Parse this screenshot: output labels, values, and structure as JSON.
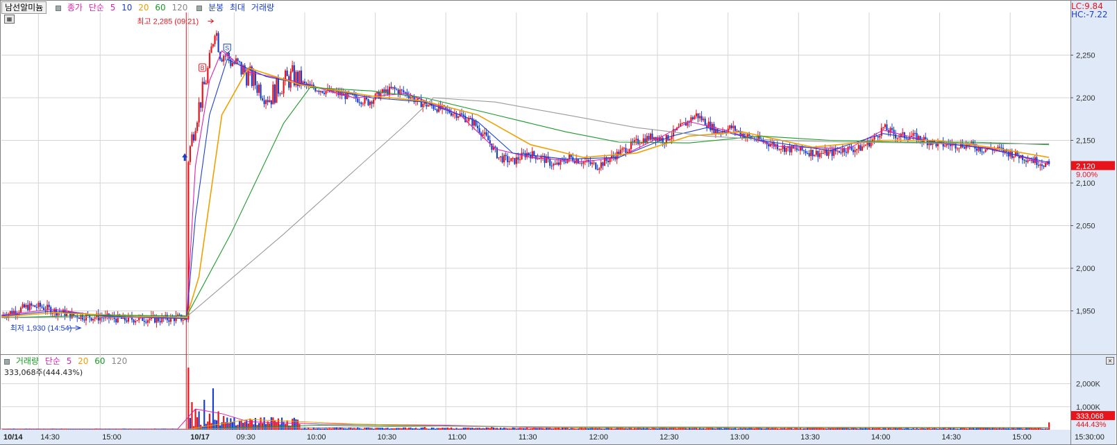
{
  "header": {
    "stock_name": "남선알미늄",
    "price_ma_legend": [
      "종가",
      "단순",
      "5",
      "10",
      "20",
      "60",
      "120"
    ],
    "extra_items": [
      "분봉",
      "최대",
      "거래량"
    ],
    "lc": "LC:9.84",
    "hc": "HC:-7.22"
  },
  "volume_header": {
    "items": [
      "거래량",
      "단순",
      "5",
      "20",
      "60",
      "120"
    ],
    "value": "333,068주(444.43%)"
  },
  "colors": {
    "up": "#e8141c",
    "down": "#1a3fcf",
    "ma5": "#e020b0",
    "ma10": "#1a3fcf",
    "ma20": "#f0a000",
    "ma60": "#1a9a28",
    "ma120": "#9a9a9a",
    "axis_bg": "#dfe9f7",
    "grid": "#d5d5d5",
    "current_bg": "#e8141c"
  },
  "icons": [
    "calendar-icon",
    "buy-marker-icon",
    "sell-marker-icon",
    "low-arrow-icon"
  ],
  "chart_data": [
    {
      "type": "candlestick",
      "title": "",
      "annotations": {
        "high": "최고 2,285 (09:21)",
        "low": "최저 1,930 (14:54)",
        "buy_marker": "B",
        "sell_marker": "S"
      },
      "x_tick_labels": [
        "10/14",
        "14:30",
        "15:00",
        "10/17",
        "09:30",
        "10:00",
        "10:30",
        "11:00",
        "11:30",
        "12:00",
        "12:30",
        "13:00",
        "13:30",
        "14:00",
        "14:30",
        "15:00",
        "15:30:00"
      ],
      "y_tick_labels": [
        "2,250",
        "2,200",
        "2,150",
        "2,100",
        "2,050",
        "2,000",
        "1,950"
      ],
      "ylim": [
        1900,
        2300
      ],
      "current_price": "2,120",
      "current_change": "9.00%",
      "close_series": [
        [
          0,
          1945
        ],
        [
          8,
          1950
        ],
        [
          15,
          1955
        ],
        [
          22,
          1955
        ],
        [
          30,
          1950
        ],
        [
          40,
          1945
        ],
        [
          50,
          1943
        ],
        [
          60,
          1942
        ],
        [
          70,
          1940
        ],
        [
          80,
          1941
        ],
        [
          90,
          1940
        ],
        [
          100,
          1942
        ],
        [
          105,
          1940
        ],
        [
          106,
          2130
        ],
        [
          110,
          2175
        ],
        [
          114,
          2205
        ],
        [
          118,
          2240
        ],
        [
          121,
          2285
        ],
        [
          124,
          2255
        ],
        [
          127,
          2250
        ],
        [
          132,
          2240
        ],
        [
          138,
          2230
        ],
        [
          145,
          2215
        ],
        [
          152,
          2200
        ],
        [
          158,
          2215
        ],
        [
          165,
          2225
        ],
        [
          172,
          2215
        ],
        [
          180,
          2210
        ],
        [
          190,
          2205
        ],
        [
          200,
          2200
        ],
        [
          208,
          2195
        ],
        [
          215,
          2205
        ],
        [
          222,
          2210
        ],
        [
          230,
          2205
        ],
        [
          236,
          2195
        ],
        [
          244,
          2190
        ],
        [
          252,
          2185
        ],
        [
          260,
          2180
        ],
        [
          268,
          2170
        ],
        [
          276,
          2150
        ],
        [
          282,
          2130
        ],
        [
          290,
          2125
        ],
        [
          298,
          2135
        ],
        [
          306,
          2130
        ],
        [
          314,
          2120
        ],
        [
          322,
          2130
        ],
        [
          330,
          2125
        ],
        [
          338,
          2120
        ],
        [
          346,
          2130
        ],
        [
          354,
          2140
        ],
        [
          362,
          2150
        ],
        [
          370,
          2155
        ],
        [
          376,
          2150
        ],
        [
          382,
          2160
        ],
        [
          388,
          2170
        ],
        [
          394,
          2180
        ],
        [
          400,
          2170
        ],
        [
          406,
          2160
        ],
        [
          414,
          2165
        ],
        [
          422,
          2155
        ],
        [
          430,
          2150
        ],
        [
          438,
          2145
        ],
        [
          446,
          2140
        ],
        [
          454,
          2138
        ],
        [
          462,
          2135
        ],
        [
          470,
          2135
        ],
        [
          478,
          2140
        ],
        [
          486,
          2140
        ],
        [
          494,
          2150
        ],
        [
          500,
          2165
        ],
        [
          508,
          2155
        ],
        [
          516,
          2155
        ],
        [
          524,
          2150
        ],
        [
          532,
          2145
        ],
        [
          540,
          2145
        ],
        [
          548,
          2145
        ],
        [
          556,
          2140
        ],
        [
          564,
          2140
        ],
        [
          572,
          2135
        ],
        [
          580,
          2130
        ],
        [
          588,
          2125
        ],
        [
          594,
          2120
        ]
      ],
      "moving_averages": [
        {
          "name": "5",
          "values": [
            [
              0,
              1945
            ],
            [
              30,
              1952
            ],
            [
              60,
              1943
            ],
            [
              105,
              1941
            ],
            [
              110,
              2120
            ],
            [
              118,
              2220
            ],
            [
              125,
              2255
            ],
            [
              140,
              2230
            ],
            [
              165,
              2220
            ],
            [
              200,
              2200
            ],
            [
              230,
              2205
            ],
            [
              260,
              2180
            ],
            [
              280,
              2140
            ],
            [
              300,
              2130
            ],
            [
              330,
              2125
            ],
            [
              350,
              2130
            ],
            [
              375,
              2155
            ],
            [
              390,
              2172
            ],
            [
              410,
              2162
            ],
            [
              440,
              2143
            ],
            [
              480,
              2140
            ],
            [
              500,
              2162
            ],
            [
              530,
              2147
            ],
            [
              560,
              2141
            ],
            [
              594,
              2122
            ]
          ]
        },
        {
          "name": "10",
          "values": [
            [
              0,
              1944
            ],
            [
              30,
              1950
            ],
            [
              60,
              1944
            ],
            [
              105,
              1941
            ],
            [
              110,
              2060
            ],
            [
              118,
              2180
            ],
            [
              128,
              2245
            ],
            [
              150,
              2225
            ],
            [
              180,
              2212
            ],
            [
              210,
              2200
            ],
            [
              240,
              2195
            ],
            [
              270,
              2172
            ],
            [
              290,
              2135
            ],
            [
              320,
              2128
            ],
            [
              350,
              2130
            ],
            [
              380,
              2155
            ],
            [
              400,
              2165
            ],
            [
              430,
              2150
            ],
            [
              470,
              2138
            ],
            [
              500,
              2158
            ],
            [
              530,
              2148
            ],
            [
              560,
              2140
            ],
            [
              594,
              2124
            ]
          ]
        },
        {
          "name": "20",
          "values": [
            [
              0,
              1943
            ],
            [
              30,
              1948
            ],
            [
              60,
              1945
            ],
            [
              105,
              1942
            ],
            [
              112,
              1990
            ],
            [
              125,
              2180
            ],
            [
              140,
              2235
            ],
            [
              170,
              2215
            ],
            [
              210,
              2202
            ],
            [
              240,
              2196
            ],
            [
              270,
              2180
            ],
            [
              300,
              2145
            ],
            [
              330,
              2130
            ],
            [
              360,
              2135
            ],
            [
              390,
              2155
            ],
            [
              420,
              2160
            ],
            [
              460,
              2142
            ],
            [
              500,
              2150
            ],
            [
              530,
              2150
            ],
            [
              560,
              2142
            ],
            [
              594,
              2130
            ]
          ]
        },
        {
          "name": "60",
          "values": [
            [
              0,
              1942
            ],
            [
              60,
              1945
            ],
            [
              105,
              1944
            ],
            [
              130,
              2040
            ],
            [
              160,
              2170
            ],
            [
              175,
              2212
            ],
            [
              210,
              2208
            ],
            [
              240,
              2200
            ],
            [
              280,
              2180
            ],
            [
              320,
              2160
            ],
            [
              350,
              2148
            ],
            [
              390,
              2147
            ],
            [
              430,
              2155
            ],
            [
              470,
              2150
            ],
            [
              510,
              2148
            ],
            [
              550,
              2148
            ],
            [
              594,
              2145
            ]
          ]
        },
        {
          "name": "120",
          "values": [
            [
              0,
              1942
            ],
            [
              105,
              1943
            ],
            [
              160,
              2040
            ],
            [
              230,
              2170
            ],
            [
              245,
              2200
            ],
            [
              280,
              2195
            ],
            [
              320,
              2180
            ],
            [
              360,
              2165
            ],
            [
              400,
              2155
            ],
            [
              440,
              2150
            ],
            [
              480,
              2148
            ],
            [
              520,
              2147
            ],
            [
              560,
              2146
            ],
            [
              594,
              2146
            ]
          ]
        }
      ]
    },
    {
      "type": "bar",
      "title": "",
      "y_tick_labels": [
        "2,000K",
        "1,000K"
      ],
      "ylim": [
        0,
        2800
      ],
      "current_volume": "333,068",
      "current_ratio": "444.43%",
      "spikes": [
        [
          106,
          2700
        ],
        [
          108,
          1200
        ],
        [
          110,
          900
        ],
        [
          112,
          800
        ],
        [
          115,
          1300
        ],
        [
          118,
          700
        ],
        [
          120,
          1800
        ],
        [
          123,
          800
        ],
        [
          126,
          600
        ],
        [
          130,
          500
        ],
        [
          136,
          400
        ],
        [
          150,
          250
        ],
        [
          240,
          120
        ],
        [
          278,
          150
        ],
        [
          380,
          100
        ],
        [
          430,
          80
        ],
        [
          500,
          90
        ],
        [
          594,
          320
        ]
      ]
    }
  ]
}
